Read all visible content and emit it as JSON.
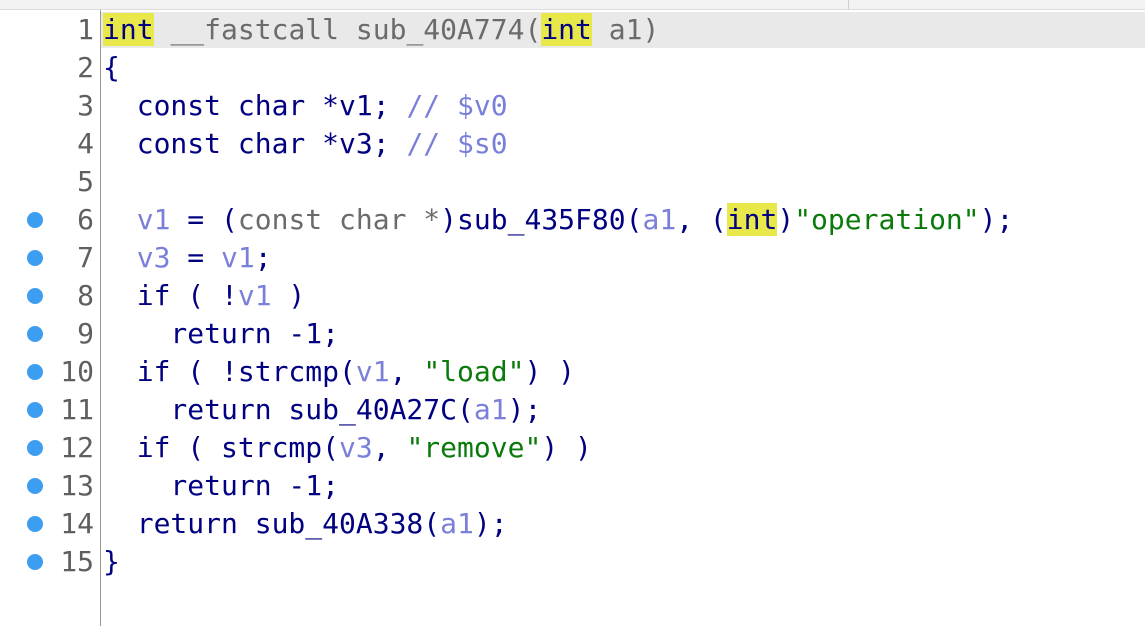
{
  "editor": {
    "title": "",
    "lines": [
      {
        "number": "1",
        "breakpoint": false,
        "tokens": [
          {
            "t": "int",
            "k": "kwhl"
          },
          {
            "t": " ",
            "k": "plain"
          },
          {
            "t": "__fastcall",
            "k": "grey"
          },
          {
            "t": " ",
            "k": "plain"
          },
          {
            "t": "sub_40A774",
            "k": "grey"
          },
          {
            "t": "(",
            "k": "grey"
          },
          {
            "t": "int",
            "k": "kwhl"
          },
          {
            "t": " a1)",
            "k": "grey"
          }
        ]
      },
      {
        "number": "2",
        "breakpoint": false,
        "tokens": [
          {
            "t": "{",
            "k": "plain"
          }
        ]
      },
      {
        "number": "3",
        "breakpoint": false,
        "tokens": [
          {
            "t": "  const char *v1; ",
            "k": "plain"
          },
          {
            "t": "// $v0",
            "k": "cmt"
          }
        ]
      },
      {
        "number": "4",
        "breakpoint": false,
        "tokens": [
          {
            "t": "  const char *v3; ",
            "k": "plain"
          },
          {
            "t": "// $s0",
            "k": "cmt"
          }
        ]
      },
      {
        "number": "5",
        "breakpoint": false,
        "tokens": []
      },
      {
        "number": "6",
        "breakpoint": true,
        "tokens": [
          {
            "t": "  ",
            "k": "plain"
          },
          {
            "t": "v1",
            "k": "var"
          },
          {
            "t": " = (",
            "k": "plain"
          },
          {
            "t": "const char *",
            "k": "cast"
          },
          {
            "t": ")sub_435F80(",
            "k": "plain"
          },
          {
            "t": "a1",
            "k": "var"
          },
          {
            "t": ", (",
            "k": "plain"
          },
          {
            "t": "int",
            "k": "kwhl"
          },
          {
            "t": ")",
            "k": "plain"
          },
          {
            "t": "\"operation\"",
            "k": "str"
          },
          {
            "t": ");",
            "k": "plain"
          }
        ]
      },
      {
        "number": "7",
        "breakpoint": true,
        "tokens": [
          {
            "t": "  ",
            "k": "plain"
          },
          {
            "t": "v3",
            "k": "var"
          },
          {
            "t": " = ",
            "k": "plain"
          },
          {
            "t": "v1",
            "k": "var"
          },
          {
            "t": ";",
            "k": "plain"
          }
        ]
      },
      {
        "number": "8",
        "breakpoint": true,
        "tokens": [
          {
            "t": "  if ( !",
            "k": "plain"
          },
          {
            "t": "v1",
            "k": "var"
          },
          {
            "t": " )",
            "k": "plain"
          }
        ]
      },
      {
        "number": "9",
        "breakpoint": true,
        "tokens": [
          {
            "t": "    return -1;",
            "k": "plain"
          }
        ]
      },
      {
        "number": "10",
        "breakpoint": true,
        "tokens": [
          {
            "t": "  if ( !strcmp(",
            "k": "plain"
          },
          {
            "t": "v1",
            "k": "var"
          },
          {
            "t": ", ",
            "k": "plain"
          },
          {
            "t": "\"load\"",
            "k": "str"
          },
          {
            "t": ") )",
            "k": "plain"
          }
        ]
      },
      {
        "number": "11",
        "breakpoint": true,
        "tokens": [
          {
            "t": "    return sub_40A27C(",
            "k": "plain"
          },
          {
            "t": "a1",
            "k": "var"
          },
          {
            "t": ");",
            "k": "plain"
          }
        ]
      },
      {
        "number": "12",
        "breakpoint": true,
        "tokens": [
          {
            "t": "  if ( strcmp(",
            "k": "plain"
          },
          {
            "t": "v3",
            "k": "var"
          },
          {
            "t": ", ",
            "k": "plain"
          },
          {
            "t": "\"remove\"",
            "k": "str"
          },
          {
            "t": ") )",
            "k": "plain"
          }
        ]
      },
      {
        "number": "13",
        "breakpoint": true,
        "tokens": [
          {
            "t": "    return -1;",
            "k": "plain"
          }
        ]
      },
      {
        "number": "14",
        "breakpoint": true,
        "tokens": [
          {
            "t": "  return sub_40A338(",
            "k": "plain"
          },
          {
            "t": "a1",
            "k": "var"
          },
          {
            "t": ");",
            "k": "plain"
          }
        ]
      },
      {
        "number": "15",
        "breakpoint": true,
        "tokens": [
          {
            "t": "}",
            "k": "plain"
          }
        ]
      }
    ]
  },
  "colors": {
    "keyword": "#000080",
    "variable": "#7a7fd9",
    "comment": "#7a7fd9",
    "string": "#0a7b0a",
    "highlight": "#e8e84a",
    "breakpoint": "#3d9df0",
    "current_line": "#e9e9e9",
    "line_number": "#5f5f5f"
  },
  "icons": {
    "breakpoint": "breakpoint-dot-icon"
  }
}
